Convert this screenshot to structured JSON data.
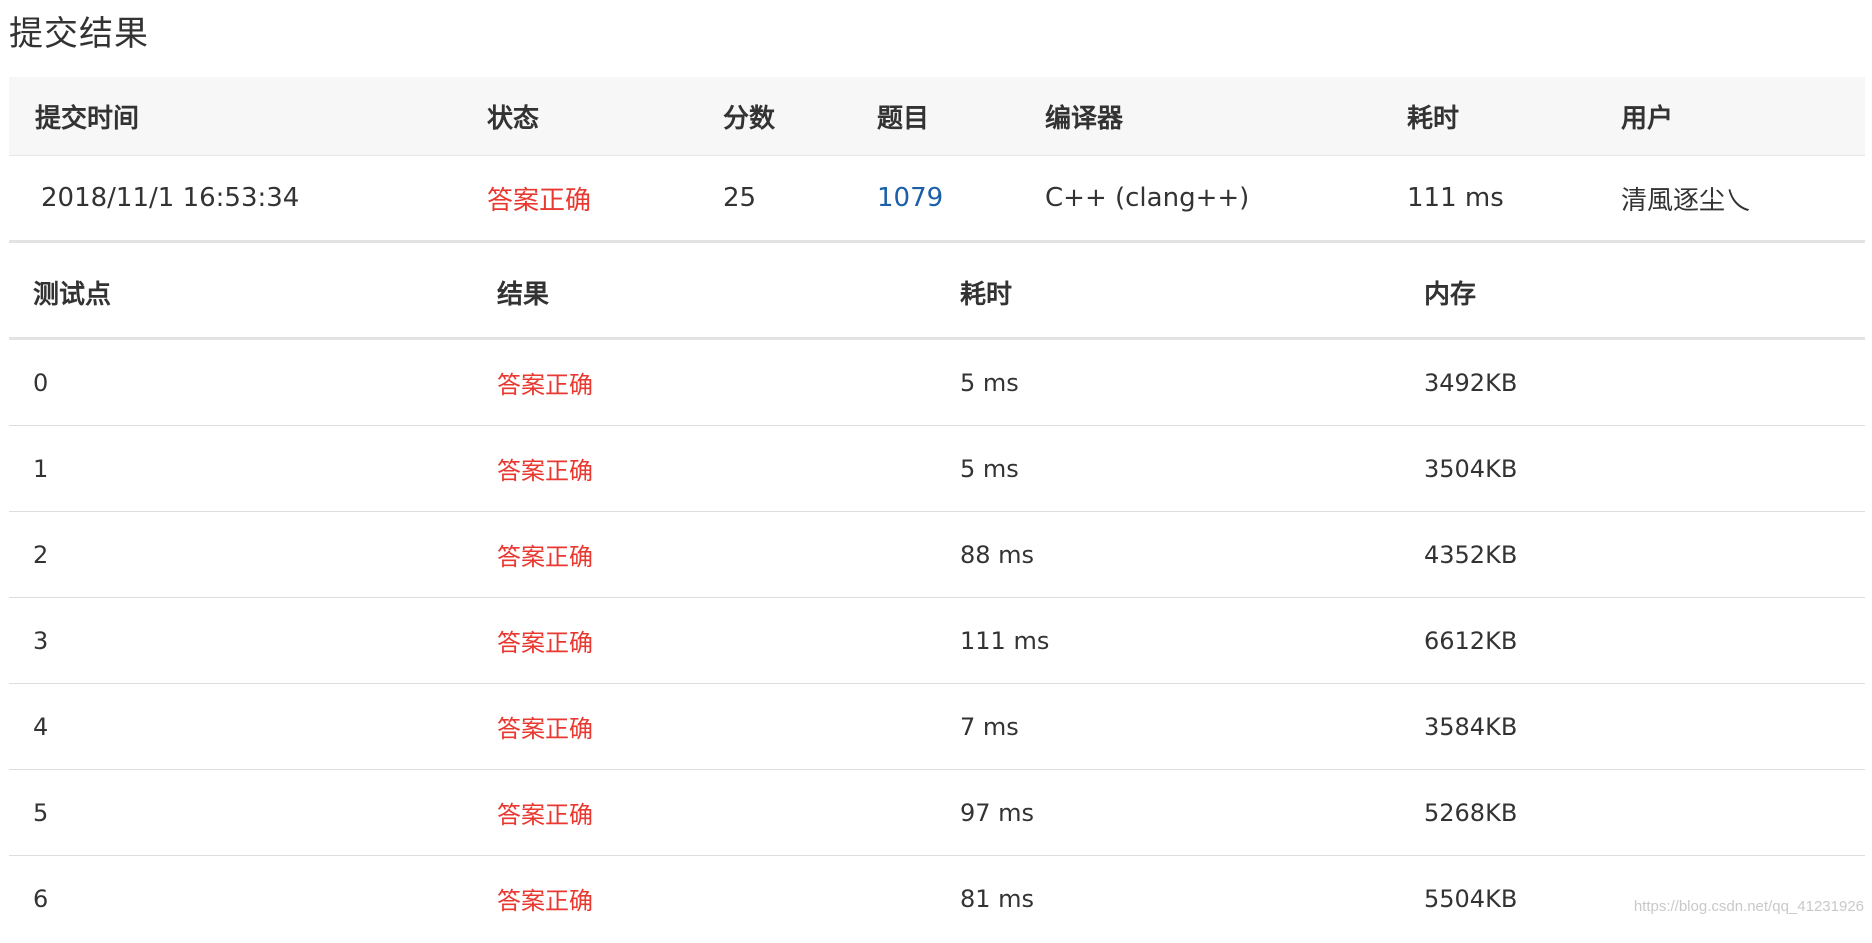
{
  "page_title": "提交结果",
  "submission": {
    "headers": {
      "time": "提交时间",
      "status": "状态",
      "score": "分数",
      "problem": "题目",
      "compiler": "编译器",
      "elapsed": "耗时",
      "user": "用户"
    },
    "row": {
      "time": "2018/11/1 16:53:34",
      "status": "答案正确",
      "score": "25",
      "problem": "1079",
      "compiler": "C++ (clang++)",
      "elapsed": "111 ms",
      "user": "清風逐尘乀"
    }
  },
  "cases": {
    "headers": {
      "case": "测试点",
      "result": "结果",
      "elapsed": "耗时",
      "memory": "内存"
    },
    "rows": [
      {
        "case": "0",
        "result": "答案正确",
        "elapsed": "5 ms",
        "memory": "3492KB"
      },
      {
        "case": "1",
        "result": "答案正确",
        "elapsed": "5 ms",
        "memory": "3504KB"
      },
      {
        "case": "2",
        "result": "答案正确",
        "elapsed": "88 ms",
        "memory": "4352KB"
      },
      {
        "case": "3",
        "result": "答案正确",
        "elapsed": "111 ms",
        "memory": "6612KB"
      },
      {
        "case": "4",
        "result": "答案正确",
        "elapsed": "7 ms",
        "memory": "3584KB"
      },
      {
        "case": "5",
        "result": "答案正确",
        "elapsed": "97 ms",
        "memory": "5268KB"
      },
      {
        "case": "6",
        "result": "答案正确",
        "elapsed": "81 ms",
        "memory": "5504KB"
      }
    ]
  },
  "watermark": "https://blog.csdn.net/qq_41231926",
  "colors": {
    "accepted": "#e8382f",
    "link": "#1a5fa8",
    "header_bg": "#f7f7f7"
  }
}
